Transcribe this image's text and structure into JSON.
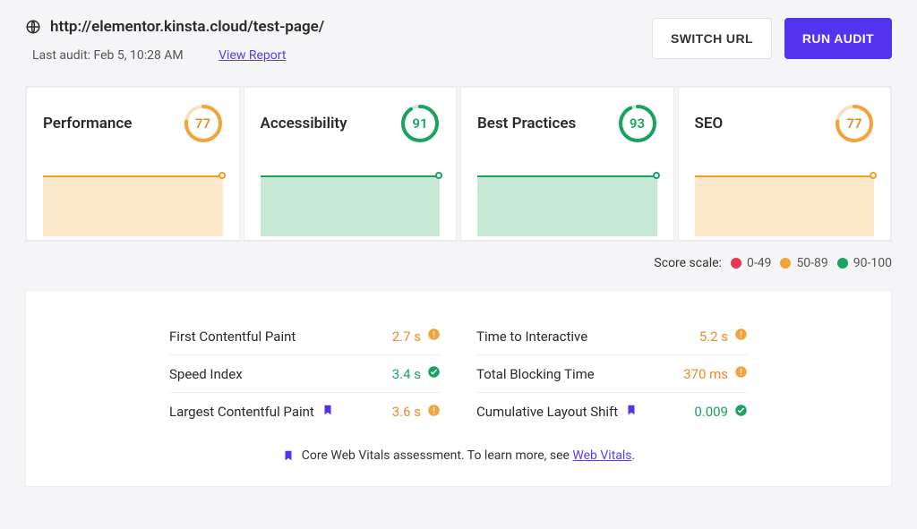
{
  "header": {
    "url": "http://elementor.kinsta.cloud/test-page/",
    "last_audit_label": "Last audit: Feb 5, 10:28 AM",
    "view_report_label": "View Report",
    "switch_url_label": "SWITCH URL",
    "run_audit_label": "RUN AUDIT"
  },
  "scale": {
    "label": "Score scale:",
    "ranges": {
      "red": "0-49",
      "orange": "50-89",
      "green": "90-100"
    }
  },
  "cards": {
    "performance": {
      "title": "Performance",
      "score": "77",
      "color": "orange",
      "stroke": "#f2a33c"
    },
    "accessibility": {
      "title": "Accessibility",
      "score": "91",
      "color": "green",
      "stroke": "#1aa260"
    },
    "best_practices": {
      "title": "Best Practices",
      "score": "93",
      "color": "green",
      "stroke": "#1aa260"
    },
    "seo": {
      "title": "SEO",
      "score": "77",
      "color": "orange",
      "stroke": "#f2a33c"
    }
  },
  "metrics": {
    "left": [
      {
        "name": "First Contentful Paint",
        "value": "2.7 s",
        "status": "warn",
        "bookmark": false
      },
      {
        "name": "Speed Index",
        "value": "3.4 s",
        "status": "pass",
        "bookmark": false
      },
      {
        "name": "Largest Contentful Paint",
        "value": "3.6 s",
        "status": "warn",
        "bookmark": true
      }
    ],
    "right": [
      {
        "name": "Time to Interactive",
        "value": "5.2 s",
        "status": "warn",
        "bookmark": false
      },
      {
        "name": "Total Blocking Time",
        "value": "370 ms",
        "status": "warn",
        "bookmark": false
      },
      {
        "name": "Cumulative Layout Shift",
        "value": "0.009",
        "status": "pass",
        "bookmark": true
      }
    ]
  },
  "vitals_note": {
    "text": "Core Web Vitals assessment. To learn more, see ",
    "link_text": "Web Vitals",
    "suffix": "."
  },
  "chart_data": {
    "type": "gauge-group",
    "gauges": [
      {
        "label": "Performance",
        "value": 77,
        "min": 0,
        "max": 100,
        "band": "50-89",
        "color": "#f2a33c"
      },
      {
        "label": "Accessibility",
        "value": 91,
        "min": 0,
        "max": 100,
        "band": "90-100",
        "color": "#1aa260"
      },
      {
        "label": "Best Practices",
        "value": 93,
        "min": 0,
        "max": 100,
        "band": "90-100",
        "color": "#1aa260"
      },
      {
        "label": "SEO",
        "value": 77,
        "min": 0,
        "max": 100,
        "band": "50-89",
        "color": "#f2a33c"
      }
    ],
    "bands": [
      {
        "label": "0-49",
        "color": "#e8384f"
      },
      {
        "label": "50-89",
        "color": "#f2a33c"
      },
      {
        "label": "90-100",
        "color": "#1aa260"
      }
    ]
  }
}
